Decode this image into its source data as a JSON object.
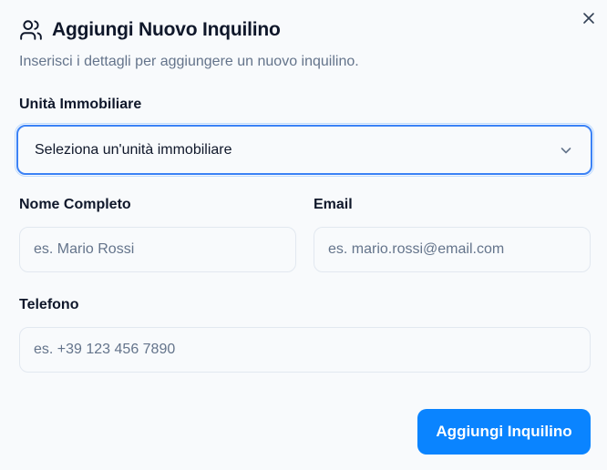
{
  "dialog": {
    "title": "Aggiungi Nuovo Inquilino",
    "subtitle": "Inserisci i dettagli per aggiungere un nuovo inquilino.",
    "header_icon": "users-icon",
    "close_icon": "close-icon"
  },
  "form": {
    "unit": {
      "label": "Unità Immobiliare",
      "selected_value": "Seleziona un'unità immobiliare",
      "icon": "chevron-down-icon"
    },
    "full_name": {
      "label": "Nome Completo",
      "placeholder": "es. Mario Rossi",
      "value": ""
    },
    "email": {
      "label": "Email",
      "placeholder": "es. mario.rossi@email.com",
      "value": ""
    },
    "phone": {
      "label": "Telefono",
      "placeholder": "es. +39 123 456 7890",
      "value": ""
    },
    "submit_label": "Aggiungi Inquilino"
  },
  "colors": {
    "accent": "#0a84ff",
    "focus_ring": "#3b82f6",
    "muted_text": "#64748b",
    "border": "#e2e8f0",
    "background": "#f8fafc"
  }
}
